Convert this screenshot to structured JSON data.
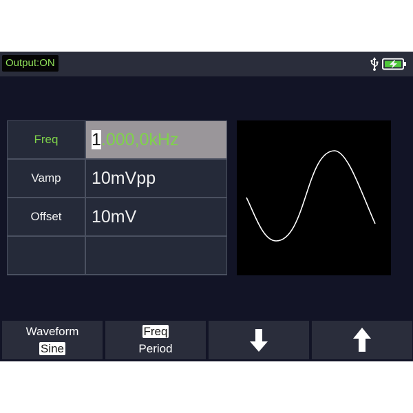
{
  "status_bar": {
    "output_label": "Output:ON",
    "usb_icon": "usb-icon",
    "battery_icon": "battery-charging-icon",
    "accent_color": "#8fe05a"
  },
  "parameters": [
    {
      "label": "Freq",
      "cursor_digit": "1",
      "value_rest": ".000,0kHz",
      "selected": true
    },
    {
      "label": "Vamp",
      "value": "10mVpp",
      "selected": false
    },
    {
      "label": "Offset",
      "value": "10mV",
      "selected": false
    },
    {
      "label": "",
      "value": "",
      "selected": false
    }
  ],
  "waveform_preview": {
    "shape": "sine",
    "color": "#ffffff"
  },
  "softkeys": [
    {
      "line1": "Waveform",
      "line2": "Sine",
      "highlight": "line2"
    },
    {
      "line1": "Freq",
      "line2": "Period",
      "highlight": "line1"
    },
    {
      "icon": "arrow-down-icon"
    },
    {
      "icon": "arrow-up-icon"
    }
  ]
}
